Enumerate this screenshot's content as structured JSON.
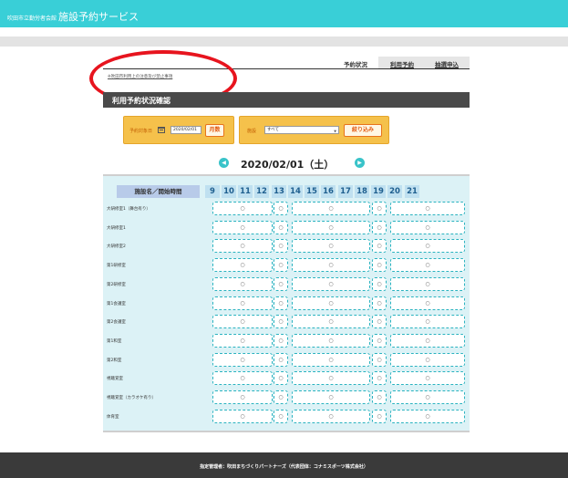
{
  "header": {
    "prefix": "吹田市立勤労者会館",
    "title": "施設予約サービス"
  },
  "tabs": {
    "status": "予約状況",
    "reserve": "利用予約",
    "lottery": "抽選申込"
  },
  "notice_link": "※吹田市利用上の注意及び禁止事項",
  "section_title": "利用予約状況確認",
  "filter": {
    "start_date_label": "予約対象日",
    "date_value": "2020/02/01",
    "month_button": "月数",
    "facility_label": "施設",
    "facility_value": "すべて",
    "narrow_button": "絞り込み"
  },
  "date_nav": {
    "date": "2020/02/01（土）",
    "prev_icon": "chevron-left-icon",
    "next_icon": "chevron-right-icon"
  },
  "grid": {
    "name_header": "施設名／開始時間",
    "hours": [
      "9",
      "10",
      "11",
      "12",
      "13",
      "14",
      "15",
      "16",
      "17",
      "18",
      "19",
      "20",
      "21"
    ],
    "available_mark": "○",
    "rows": [
      {
        "name": "大研修室1（舞台有り）",
        "cells": [
          "○",
          "○",
          "○",
          "○",
          "○"
        ]
      },
      {
        "name": "大研修室1",
        "cells": [
          "○",
          "○",
          "○",
          "○",
          "○"
        ]
      },
      {
        "name": "大研修室2",
        "cells": [
          "○",
          "○",
          "○",
          "○",
          "○"
        ]
      },
      {
        "name": "第1研修室",
        "cells": [
          "○",
          "○",
          "○",
          "○",
          "○"
        ]
      },
      {
        "name": "第2研修室",
        "cells": [
          "○",
          "○",
          "○",
          "○",
          "○"
        ]
      },
      {
        "name": "第1会議室",
        "cells": [
          "○",
          "○",
          "○",
          "○",
          "○"
        ]
      },
      {
        "name": "第2会議室",
        "cells": [
          "○",
          "○",
          "○",
          "○",
          "○"
        ]
      },
      {
        "name": "第1和室",
        "cells": [
          "○",
          "○",
          "○",
          "○",
          "○"
        ]
      },
      {
        "name": "第2和室",
        "cells": [
          "○",
          "○",
          "○",
          "○",
          "○"
        ]
      },
      {
        "name": "視聴覚室",
        "cells": [
          "○",
          "○",
          "○",
          "○",
          "○"
        ]
      },
      {
        "name": "視聴覚室（カラオケ有り）",
        "cells": [
          "○",
          "○",
          "○",
          "○",
          "○"
        ]
      },
      {
        "name": "体育室",
        "cells": [
          "○",
          "○",
          "○",
          "○",
          "○"
        ]
      }
    ]
  },
  "footer": "指定管理者：吹田まちづくりパートナーズ（代表団体：コナミスポーツ株式会社）",
  "colors": {
    "header": "#39cfd7",
    "annotation_oval": "#e7141e",
    "filter_box": "#f5c14b",
    "grid_bg": "#dcf2f6"
  }
}
